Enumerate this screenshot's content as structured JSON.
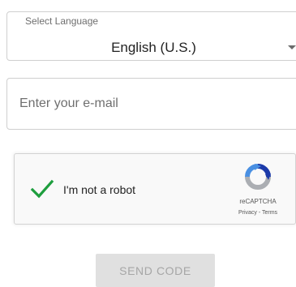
{
  "language_select": {
    "label": "Select Language",
    "value": "English (U.S.)",
    "arrow_icon": "caret-down-icon"
  },
  "email": {
    "value": "",
    "placeholder": "Enter your e-mail"
  },
  "recaptcha": {
    "checked": true,
    "label": "I'm not a robot",
    "brand": "reCAPTCHA",
    "privacy_label": "Privacy",
    "separator": " - ",
    "terms_label": "Terms",
    "check_color": "#1e9e3e",
    "logo_icon": "recaptcha-logo-icon"
  },
  "send_button": {
    "label": "SEND CODE",
    "disabled": true
  }
}
